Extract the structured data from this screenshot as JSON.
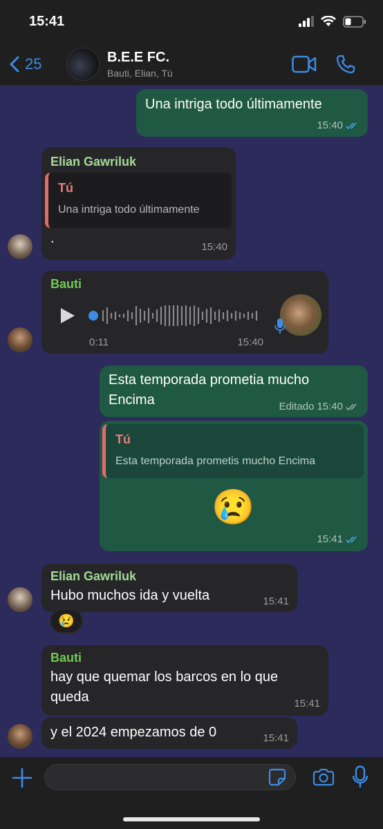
{
  "status": {
    "time": "15:41"
  },
  "header": {
    "back_count": "25",
    "title": "B.E.E FC.",
    "subtitle": "Bauti, Elian, Tú"
  },
  "colors": {
    "accent": "#3b8de7",
    "outgoing": "#1f5944",
    "incoming": "#262628",
    "green_name": "#72c954",
    "light_green_name": "#a5d99a",
    "quote_red": "#e06c6c"
  },
  "messages": [
    {
      "type": "out",
      "text": "Una intriga todo últimamente",
      "time": "15:40",
      "status": "read"
    },
    {
      "type": "in",
      "sender": "Elian Gawriluk",
      "quote_author": "Tú",
      "quote_text": "Una intriga todo últimamente",
      "text": ".",
      "time": "15:40"
    },
    {
      "type": "in-voice",
      "sender": "Bauti",
      "duration": "0:11",
      "time": "15:40"
    },
    {
      "type": "out",
      "text_line1": "Esta temporada prometia mucho",
      "text_line2": "Encima",
      "edited": "Editado",
      "time": "15:40",
      "status": "delivered"
    },
    {
      "type": "out",
      "quote_author": "Tú",
      "quote_text": "Esta temporada prometis mucho Encima",
      "emoji": "😢",
      "time": "15:41",
      "status": "read"
    },
    {
      "type": "in",
      "sender": "Elian Gawriluk",
      "text": "Hubo muchos ida y vuelta",
      "time": "15:41",
      "reaction": "😢"
    },
    {
      "type": "in",
      "sender": "Bauti",
      "text_line1": "hay que quemar los barcos en lo que",
      "text_line2": "queda",
      "time": "15:41"
    },
    {
      "type": "in",
      "text": "y el 2024 empezamos de 0",
      "time": "15:41"
    }
  ],
  "input": {
    "placeholder": ""
  }
}
